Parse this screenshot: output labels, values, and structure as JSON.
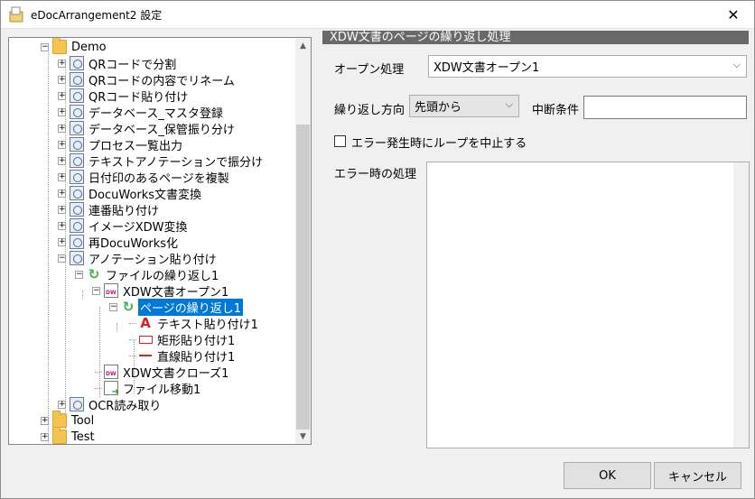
{
  "window": {
    "title": "eDocArrangement2 設定",
    "close_glyph": "✕"
  },
  "tree": {
    "items": [
      {
        "label": "Demo",
        "icon": "folder-icon",
        "expander": "−"
      },
      {
        "label": "QRコードで分割",
        "icon": "command-icon",
        "expander": "+"
      },
      {
        "label": "QRコードの内容でリネーム",
        "icon": "command-icon",
        "expander": "+"
      },
      {
        "label": "QRコード貼り付け",
        "icon": "command-icon",
        "expander": "+"
      },
      {
        "label": "データベース_マスタ登録",
        "icon": "command-icon",
        "expander": "+"
      },
      {
        "label": "データベース_保管振り分け",
        "icon": "command-icon",
        "expander": "+"
      },
      {
        "label": "プロセス一覧出力",
        "icon": "command-icon",
        "expander": "+"
      },
      {
        "label": "テキストアノテーションで振分け",
        "icon": "command-icon",
        "expander": "+"
      },
      {
        "label": "日付印のあるページを複製",
        "icon": "command-icon",
        "expander": "+"
      },
      {
        "label": "DocuWorks文書変換",
        "icon": "command-icon",
        "expander": "+"
      },
      {
        "label": "連番貼り付け",
        "icon": "command-icon",
        "expander": "+"
      },
      {
        "label": "イメージXDW変換",
        "icon": "command-icon",
        "expander": "+"
      },
      {
        "label": "再DocuWorks化",
        "icon": "command-icon",
        "expander": "+"
      },
      {
        "label": "アノテーション貼り付け",
        "icon": "command-icon",
        "expander": "−"
      },
      {
        "label": "ファイルの繰り返し1",
        "icon": "loop-icon",
        "expander": "−"
      },
      {
        "label": "XDW文書オープン1",
        "icon": "xdw-document-icon",
        "expander": "−"
      },
      {
        "label": "ページの繰り返し1",
        "icon": "loop-icon",
        "expander": "−"
      },
      {
        "label": "テキスト貼り付け1",
        "icon": "text-annotation-icon",
        "expander": ""
      },
      {
        "label": "矩形貼り付け1",
        "icon": "rectangle-annotation-icon",
        "expander": ""
      },
      {
        "label": "直線貼り付け1",
        "icon": "line-annotation-icon",
        "expander": ""
      },
      {
        "label": "XDW文書クローズ1",
        "icon": "xdw-document-icon",
        "expander": ""
      },
      {
        "label": "ファイル移動1",
        "icon": "file-move-icon",
        "expander": ""
      },
      {
        "label": "OCR読み取り",
        "icon": "command-icon",
        "expander": "+"
      },
      {
        "label": "Tool",
        "icon": "folder-icon",
        "expander": "+"
      },
      {
        "label": "Test",
        "icon": "folder-icon",
        "expander": "+"
      }
    ],
    "selected": "ページの繰り返し1",
    "scroll_up_glyph": "▲",
    "scroll_down_glyph": "▼"
  },
  "panel": {
    "header": "XDW文書のページの繰り返し処理",
    "open_label": "オープン処理",
    "open_value": "XDW文書オープン1",
    "direction_label": "繰り返し方向",
    "direction_value": "先頭から",
    "break_label": "中断条件",
    "break_value": "",
    "stop_on_error_label": "エラー発生時にループを中止する",
    "stop_on_error_checked": false,
    "error_handling_label": "エラー時の処理",
    "error_handling_value": "",
    "dropdown_glyph": "⌵"
  },
  "buttons": {
    "ok": "OK",
    "cancel": "キャンセル"
  }
}
